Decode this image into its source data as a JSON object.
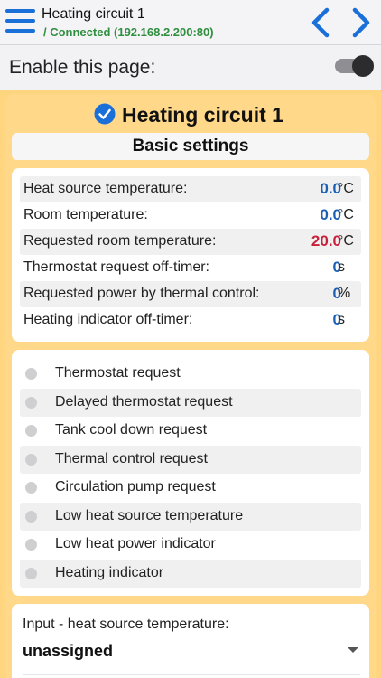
{
  "header": {
    "title": "Heating circuit 1",
    "status": "/ Connected (192.168.2.200:80)",
    "menu_icon": "hamburger-menu-icon",
    "prev_icon": "chevron-left-icon",
    "next_icon": "chevron-right-icon",
    "accent_color": "#1a6fd8",
    "status_color": "#2f8f3f"
  },
  "enable": {
    "label": "Enable this page:",
    "enabled": true
  },
  "panel": {
    "title": "Heating circuit 1",
    "title_icon": "checkmark-circle-icon",
    "section": "Basic settings",
    "background_color": "#ffd88a"
  },
  "values": [
    {
      "label": "Heat source temperature:",
      "value": "0.0",
      "unit": "°C",
      "color": "#1a5fb4"
    },
    {
      "label": "Room temperature:",
      "value": "0.0",
      "unit": "°C",
      "color": "#1a5fb4"
    },
    {
      "label": "Requested room temperature:",
      "value": "20.0",
      "unit": "°C",
      "color": "#c8203c"
    },
    {
      "label": "Thermostat request off-timer:",
      "value": "0",
      "unit": "s",
      "color": "#1a5fb4"
    },
    {
      "label": "Requested power by thermal control:",
      "value": "0",
      "unit": "%",
      "color": "#1a5fb4"
    },
    {
      "label": "Heating indicator off-timer:",
      "value": "0",
      "unit": "s",
      "color": "#1a5fb4"
    }
  ],
  "flags": [
    {
      "label": "Thermostat request",
      "active": false
    },
    {
      "label": "Delayed thermostat request",
      "active": false
    },
    {
      "label": "Tank cool down request",
      "active": false
    },
    {
      "label": "Thermal control request",
      "active": false
    },
    {
      "label": "Circulation pump request",
      "active": false
    },
    {
      "label": "Low heat source temperature",
      "active": false
    },
    {
      "label": "Low heat power indicator",
      "active": false
    },
    {
      "label": "Heating indicator",
      "active": false
    }
  ],
  "input": {
    "label": "Input - heat source temperature:",
    "selected": "unassigned"
  }
}
